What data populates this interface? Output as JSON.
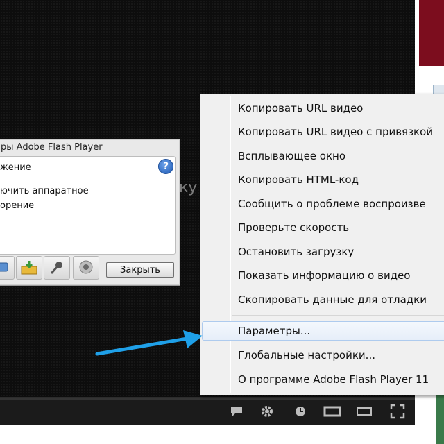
{
  "player": {
    "ghost_text": "ку",
    "controls": {
      "icons": [
        "annotations-icon",
        "gear-icon",
        "watch-later-icon",
        "theater-mode-icon",
        "mini-player-icon",
        "fullscreen-icon"
      ]
    }
  },
  "flash_dialog": {
    "title": "ры Adobe Flash Player",
    "heading": "жение",
    "checkbox_line1": "ючить аппаратное",
    "checkbox_line2": "орение",
    "close_label": "Закрыть",
    "tab_icons": [
      "display-icon",
      "storage-icon",
      "microphone-icon",
      "camera-icon"
    ]
  },
  "context_menu": {
    "items": [
      "Копировать URL видео",
      "Копировать URL видео с привязкой",
      "Всплывающее окно",
      "Копировать HTML-код",
      "Сообщить о проблеме воспроизве",
      "Проверьте скорость",
      "Остановить загрузку",
      "Показать информацию о видео",
      "Скопировать данные для отладки"
    ],
    "flash_items": [
      "Параметры...",
      "Глобальные настройки...",
      "О программе Adobe Flash Player 11"
    ]
  },
  "colors": {
    "arrow": "#1fa0e8",
    "menu_hover_border": "#aecbee",
    "side_red": "#7c0d1e"
  }
}
